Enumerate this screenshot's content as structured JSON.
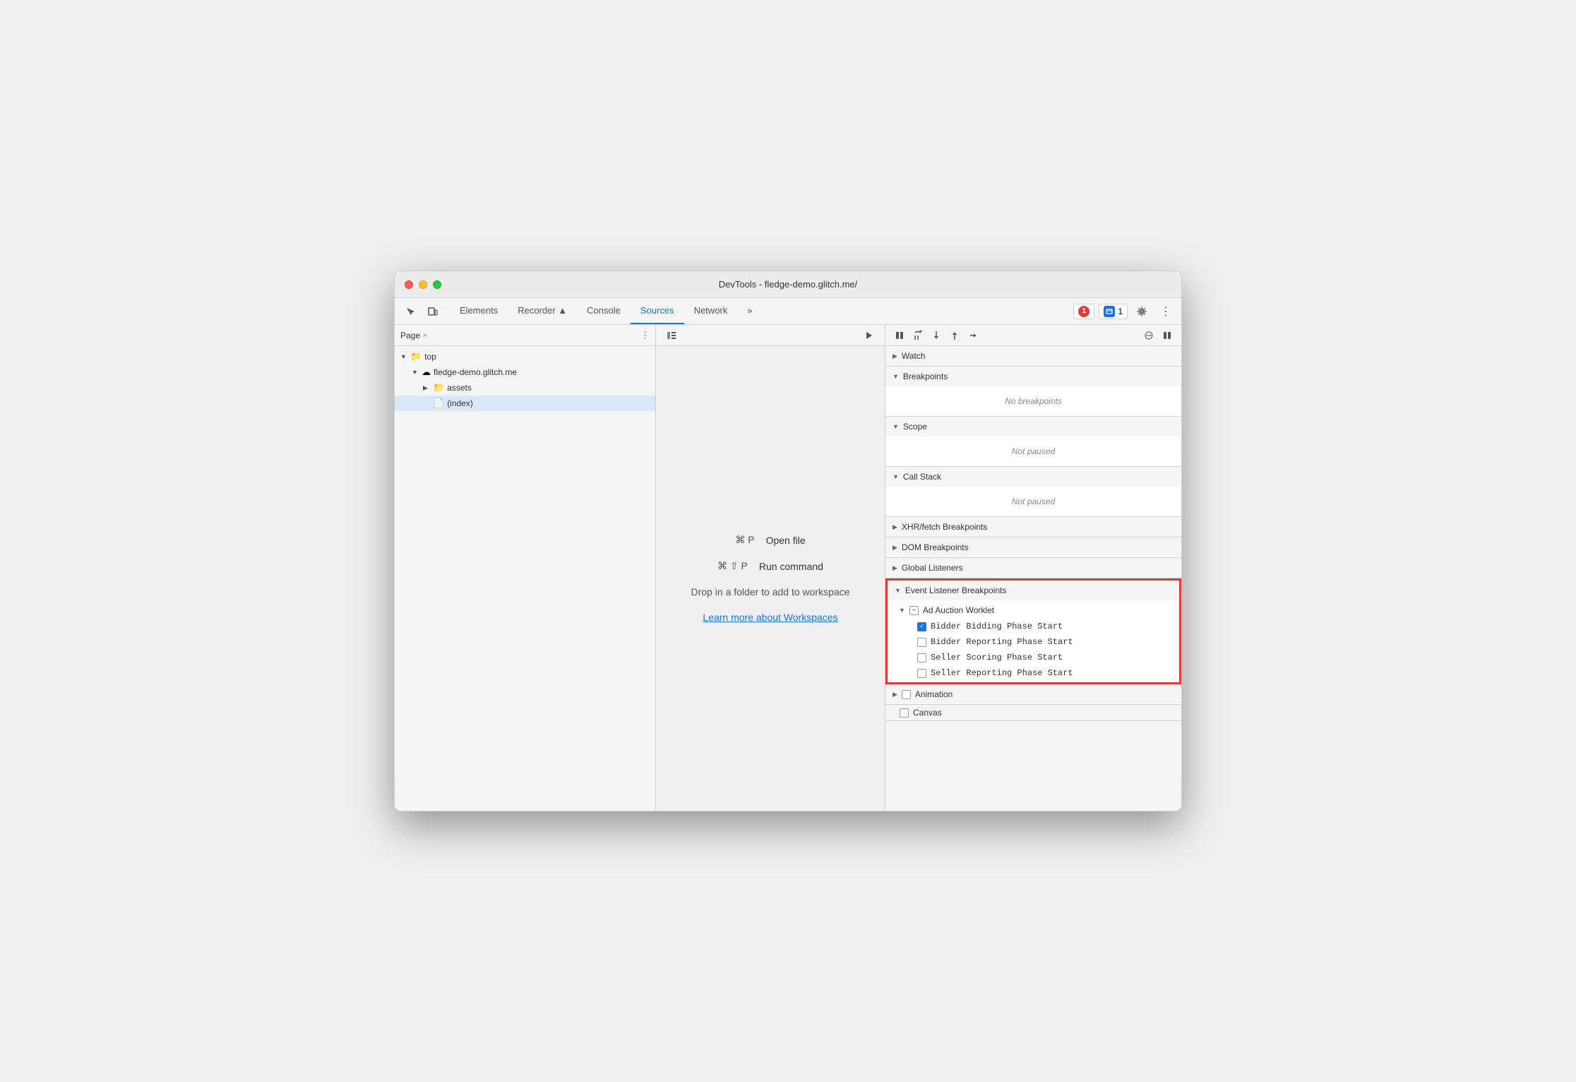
{
  "window": {
    "title": "DevTools - fledge-demo.glitch.me/"
  },
  "toolbar": {
    "tabs": [
      {
        "label": "Elements",
        "active": false
      },
      {
        "label": "Recorder ▲",
        "active": false
      },
      {
        "label": "Console",
        "active": false
      },
      {
        "label": "Sources",
        "active": true
      },
      {
        "label": "Network",
        "active": false
      }
    ],
    "more_tabs": "»",
    "errors_count": "1",
    "messages_count": "1"
  },
  "left_panel": {
    "header": "Page",
    "tree": [
      {
        "level": 0,
        "label": "top",
        "has_chevron": true,
        "expanded": true,
        "icon": "folder"
      },
      {
        "level": 1,
        "label": "fledge-demo.glitch.me",
        "has_chevron": true,
        "expanded": true,
        "icon": "cloud"
      },
      {
        "level": 2,
        "label": "assets",
        "has_chevron": true,
        "expanded": false,
        "icon": "folder-blue"
      },
      {
        "level": 2,
        "label": "(index)",
        "has_chevron": false,
        "expanded": false,
        "icon": "file",
        "selected": true
      }
    ]
  },
  "middle_panel": {
    "shortcut1": {
      "keys": "⌘ P",
      "label": "Open file"
    },
    "shortcut2": {
      "keys": "⌘ ⇧ P",
      "label": "Run command"
    },
    "drop_text": "Drop in a folder to add to workspace",
    "workspace_link": "Learn more about Workspaces"
  },
  "right_panel": {
    "sections": [
      {
        "id": "watch",
        "label": "Watch",
        "expanded": false,
        "chevron": "▶"
      },
      {
        "id": "breakpoints",
        "label": "Breakpoints",
        "expanded": true,
        "chevron": "▼",
        "empty_text": "No breakpoints"
      },
      {
        "id": "scope",
        "label": "Scope",
        "expanded": true,
        "chevron": "▼",
        "empty_text": "Not paused"
      },
      {
        "id": "call_stack",
        "label": "Call Stack",
        "expanded": true,
        "chevron": "▼",
        "empty_text": "Not paused"
      },
      {
        "id": "xhr",
        "label": "XHR/fetch Breakpoints",
        "expanded": false,
        "chevron": "▶"
      },
      {
        "id": "dom",
        "label": "DOM Breakpoints",
        "expanded": false,
        "chevron": "▶"
      },
      {
        "id": "global",
        "label": "Global Listeners",
        "expanded": false,
        "chevron": "▶"
      },
      {
        "id": "event_listener",
        "label": "Event Listener Breakpoints",
        "expanded": true,
        "chevron": "▼",
        "highlighted": true,
        "group": {
          "label": "Ad Auction Worklet",
          "expanded": true,
          "items": [
            {
              "label": "Bidder Bidding Phase Start",
              "checked": true
            },
            {
              "label": "Bidder Reporting Phase Start",
              "checked": false
            },
            {
              "label": "Seller Scoring Phase Start",
              "checked": false
            },
            {
              "label": "Seller Reporting Phase Start",
              "checked": false
            }
          ]
        }
      },
      {
        "id": "animation",
        "label": "Animation",
        "expanded": false,
        "chevron": "▶",
        "has_checkbox": true
      },
      {
        "id": "canvas",
        "label": "Canvas",
        "expanded": false,
        "partial_label": "Canvas",
        "has_checkbox": true
      }
    ]
  }
}
